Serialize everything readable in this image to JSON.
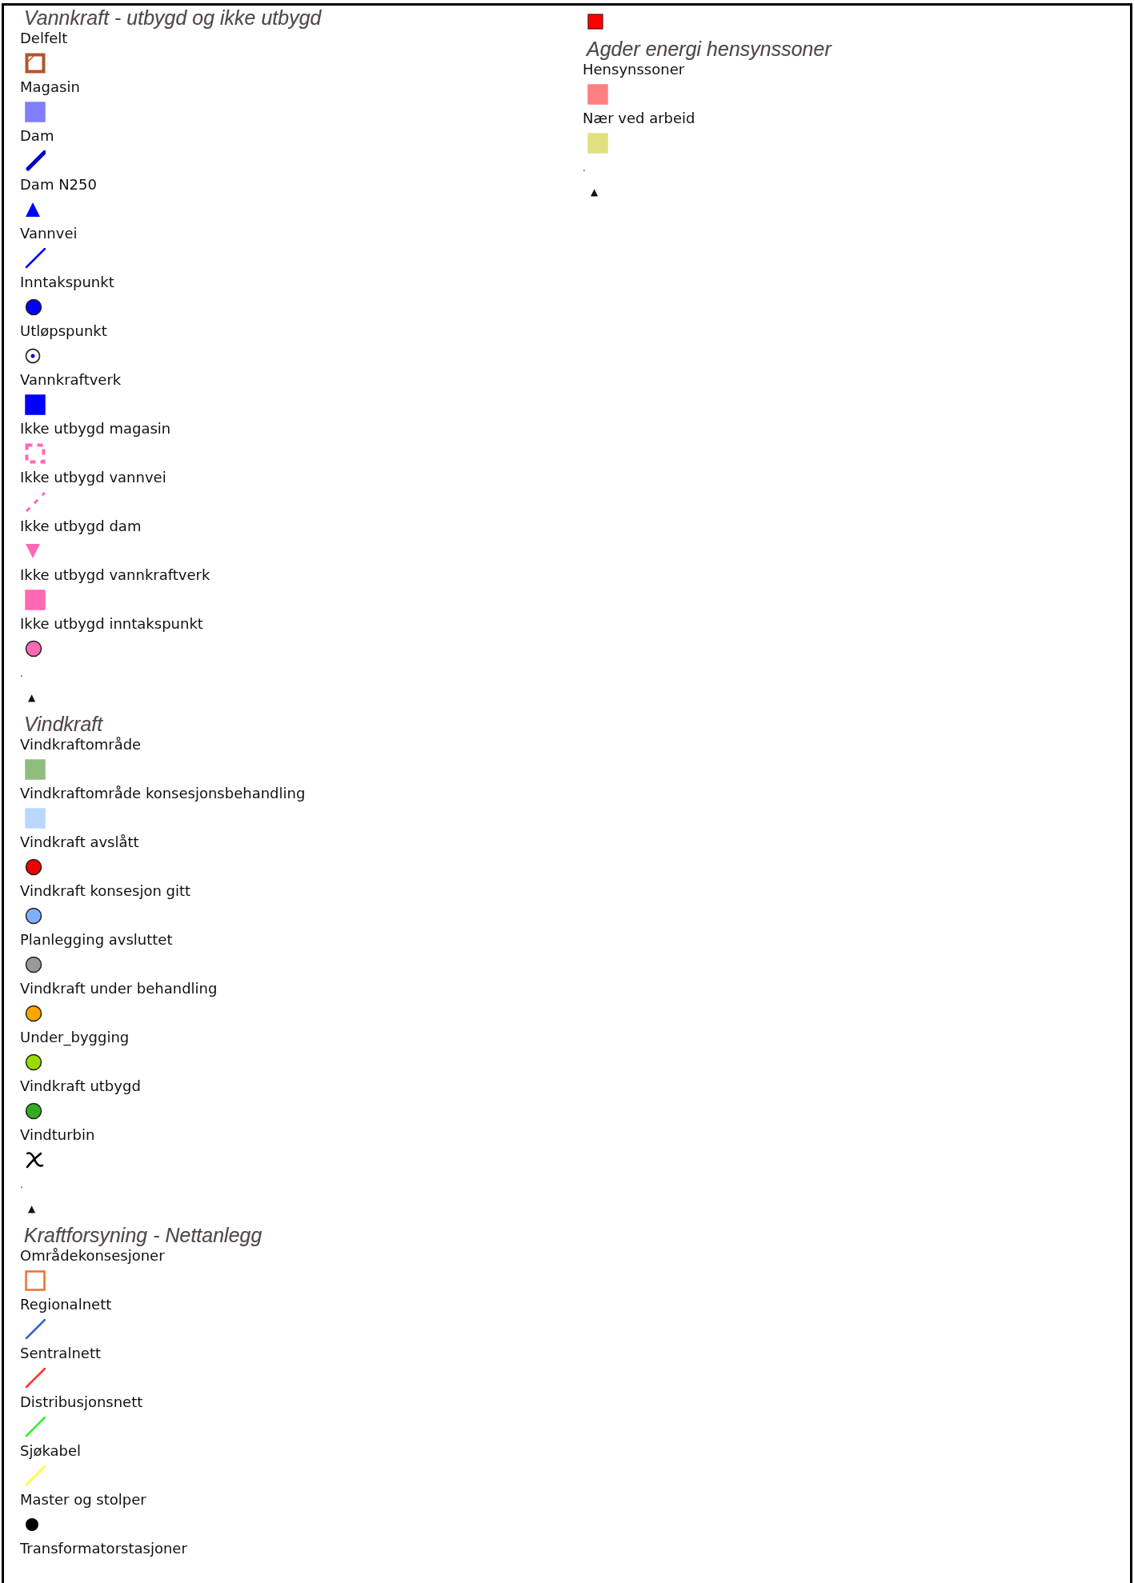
{
  "columns": [
    {
      "entries": [
        {
          "kind": "heading",
          "text": "Vannkraft - utbygd og ikke utbygd"
        },
        {
          "kind": "label",
          "text": "Delfelt"
        },
        {
          "kind": "cornersquare",
          "color": "#b5532a"
        },
        {
          "kind": "label",
          "text": "Magasin"
        },
        {
          "kind": "square",
          "color": "#7f7fff"
        },
        {
          "kind": "label",
          "text": "Dam"
        },
        {
          "kind": "thickline",
          "color": "#0000cc"
        },
        {
          "kind": "label",
          "text": "Dam N250"
        },
        {
          "kind": "triangle",
          "color": "#0000ff"
        },
        {
          "kind": "label",
          "text": "Vannvei"
        },
        {
          "kind": "line",
          "color": "#0000ff"
        },
        {
          "kind": "label",
          "text": "Inntakspunkt"
        },
        {
          "kind": "circle",
          "color": "#0000ff"
        },
        {
          "kind": "label",
          "text": "Utløpspunkt"
        },
        {
          "kind": "target",
          "color": "#333333"
        },
        {
          "kind": "label",
          "text": "Vannkraftverk"
        },
        {
          "kind": "square",
          "color": "#0000ff"
        },
        {
          "kind": "label",
          "text": "Ikke utbygd magasin"
        },
        {
          "kind": "dashedsquare",
          "color": "#ff69b4"
        },
        {
          "kind": "label",
          "text": "Ikke utbygd vannvei"
        },
        {
          "kind": "dashedline",
          "color": "#ff69b4"
        },
        {
          "kind": "label",
          "text": "Ikke utbygd dam"
        },
        {
          "kind": "downtriangle",
          "color": "#ff69b4"
        },
        {
          "kind": "label",
          "text": "Ikke utbygd vannkraftverk"
        },
        {
          "kind": "square",
          "color": "#ff69b4"
        },
        {
          "kind": "label",
          "text": "Ikke utbygd inntakspunkt"
        },
        {
          "kind": "circle",
          "color": "#ff69b4"
        },
        {
          "kind": "dot",
          "text": "."
        },
        {
          "kind": "toggle",
          "text": "▲"
        },
        {
          "kind": "heading",
          "text": "Vindkraft"
        },
        {
          "kind": "label",
          "text": "Vindkraftområde"
        },
        {
          "kind": "square",
          "color": "#8fbc7f"
        },
        {
          "kind": "label",
          "text": "Vindkraftområde konsesjonsbehandling"
        },
        {
          "kind": "square",
          "color": "#b8d8ff"
        },
        {
          "kind": "label",
          "text": "Vindkraft avslått"
        },
        {
          "kind": "circle",
          "color": "#ee0000"
        },
        {
          "kind": "label",
          "text": "Vindkraft konsesjon gitt"
        },
        {
          "kind": "circle",
          "color": "#7fb0ff"
        },
        {
          "kind": "label",
          "text": "Planlegging avsluttet"
        },
        {
          "kind": "circle",
          "color": "#999999"
        },
        {
          "kind": "label",
          "text": "Vindkraft under behandling"
        },
        {
          "kind": "circle",
          "color": "#ffa500"
        },
        {
          "kind": "label",
          "text": "Under_bygging"
        },
        {
          "kind": "circle",
          "color": "#99dd00"
        },
        {
          "kind": "label",
          "text": "Vindkraft utbygd"
        },
        {
          "kind": "circle",
          "color": "#33aa22"
        },
        {
          "kind": "label",
          "text": "Vindturbin"
        },
        {
          "kind": "turbine",
          "color": "#000000"
        },
        {
          "kind": "dot",
          "text": "."
        },
        {
          "kind": "toggle",
          "text": "▲"
        },
        {
          "kind": "heading",
          "text": "Kraftforsyning - Nettanlegg"
        },
        {
          "kind": "label",
          "text": "Områdekonsesjoner"
        },
        {
          "kind": "outlinesquare",
          "color": "#f07030"
        },
        {
          "kind": "label",
          "text": "Regionalnett"
        },
        {
          "kind": "line",
          "color": "#3366cc"
        },
        {
          "kind": "label",
          "text": "Sentralnett"
        },
        {
          "kind": "line",
          "color": "#ff3333"
        },
        {
          "kind": "label",
          "text": "Distribusjonsnett"
        },
        {
          "kind": "line",
          "color": "#33ee33"
        },
        {
          "kind": "label",
          "text": "Sjøkabel"
        },
        {
          "kind": "line",
          "color": "#ffff33"
        },
        {
          "kind": "label",
          "text": "Master og stolper"
        },
        {
          "kind": "point",
          "color": "#000000"
        },
        {
          "kind": "label",
          "text": "Transformatorstasjoner"
        }
      ]
    },
    {
      "entries": [
        {
          "kind": "smallsquare",
          "color": "#ff0000"
        },
        {
          "kind": "heading",
          "text": "Agder energi hensynssoner"
        },
        {
          "kind": "label",
          "text": "Hensynssoner"
        },
        {
          "kind": "square",
          "color": "#ff8080"
        },
        {
          "kind": "label",
          "text": "Nær ved arbeid"
        },
        {
          "kind": "square",
          "color": "#e0e080"
        },
        {
          "kind": "dot",
          "text": "."
        },
        {
          "kind": "toggle",
          "text": "▲"
        }
      ]
    }
  ]
}
